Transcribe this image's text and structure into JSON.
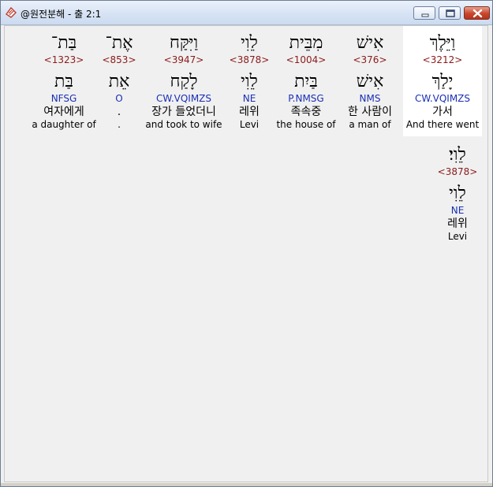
{
  "window": {
    "title": "@원전분해 - 출 2:1",
    "icon": "bible-icon",
    "buttons": [
      "minimize",
      "maximize",
      "close"
    ]
  },
  "colors": {
    "strong": "#8b1a1a",
    "morph": "#1a2fb5",
    "selected_bg": "#ffffff"
  },
  "verse": {
    "words": [
      {
        "heb": "וַיֵּלֶךְ",
        "strong": "<3212>",
        "lemma": "יָלַךְ",
        "morph": "CW.VQIMZS",
        "kor": "가서",
        "eng": "And there went",
        "selected": true
      },
      {
        "heb": "אִישׁ",
        "strong": "<376>",
        "lemma": "אִישׁ",
        "morph": "NMS",
        "kor": "한 사람이",
        "eng": "a man of",
        "selected": false
      },
      {
        "heb": "מִבֵּית",
        "strong": "<1004>",
        "lemma": "בַּיִת",
        "morph": "P.NMSG",
        "kor": "족속중",
        "eng": "the house of",
        "selected": false
      },
      {
        "heb": "לֵוִי",
        "strong": "<3878>",
        "lemma": "לֵוִי",
        "morph": "NE",
        "kor": "레위",
        "eng": "Levi",
        "selected": false
      },
      {
        "heb": "וַיִּקַּח",
        "strong": "<3947>",
        "lemma": "לָקַח",
        "morph": "CW.VQIMZS",
        "kor": "장가 들었더니",
        "eng": "and took to wife",
        "selected": false
      },
      {
        "heb": "אֶת־",
        "strong": "<853>",
        "lemma": "אֵת",
        "morph": "O",
        "kor": ".",
        "eng": ".",
        "selected": false
      },
      {
        "heb": "בַּת־",
        "strong": "<1323>",
        "lemma": "בַּת",
        "morph": "NFSG",
        "kor": "여자에게",
        "eng": "a daughter of",
        "selected": false
      },
      {
        "heb": "לֵוִי׃",
        "strong": "<3878>",
        "lemma": "לֵוִי",
        "morph": "NE",
        "kor": "레위",
        "eng": "Levi",
        "selected": false
      }
    ]
  }
}
